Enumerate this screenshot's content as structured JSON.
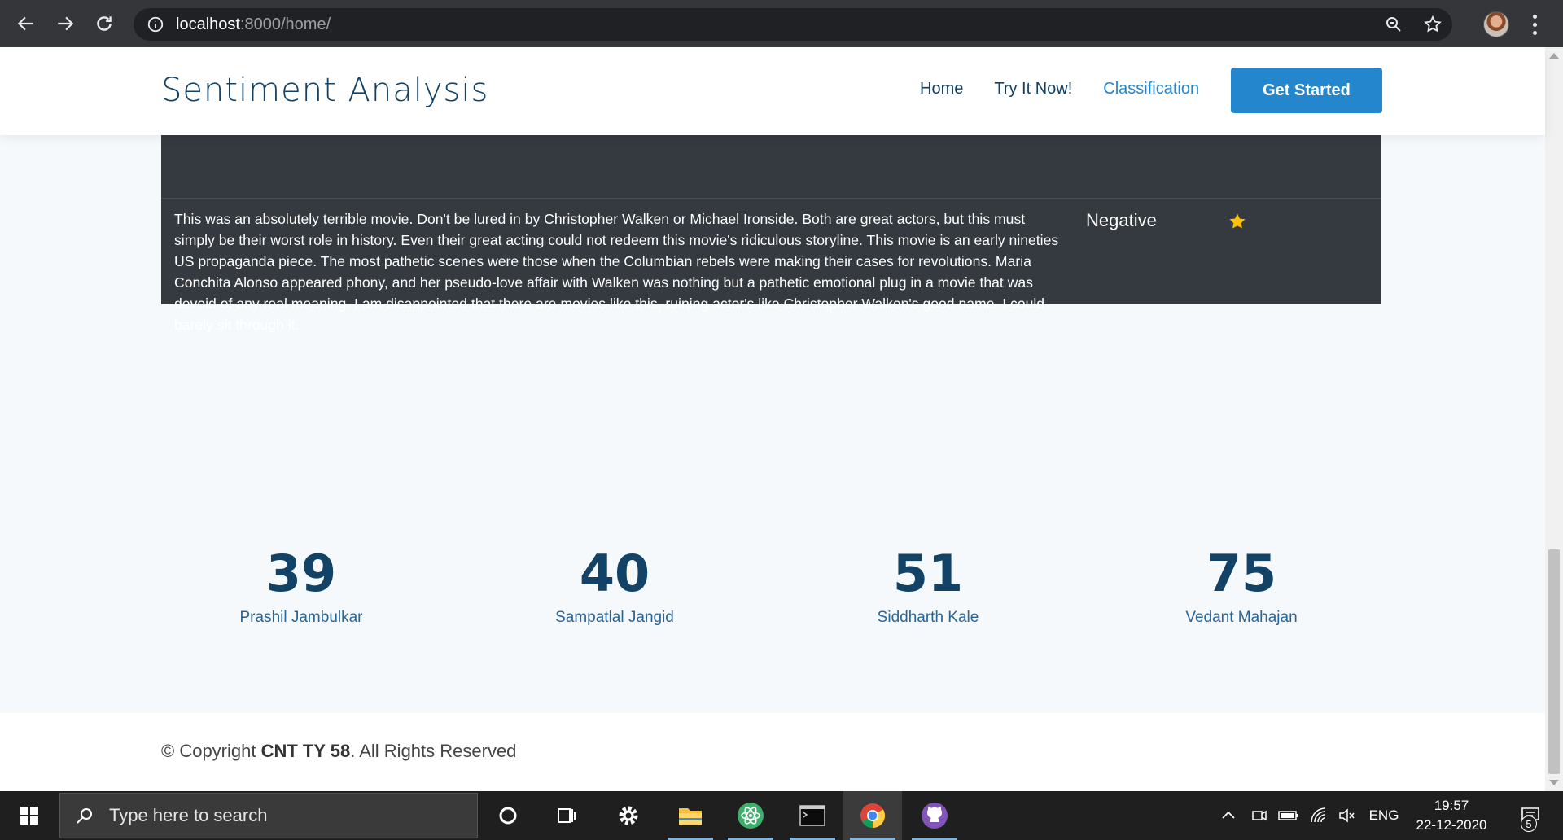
{
  "browser": {
    "url_host": "localhost",
    "url_path": ":8000/home/"
  },
  "site": {
    "logo": "Sentiment Analysis",
    "nav": {
      "home": "Home",
      "try_it_now": "Try It Now!",
      "classification": "Classification"
    },
    "cta": "Get Started"
  },
  "review": {
    "text": "This was an absolutely terrible movie. Don't be lured in by Christopher Walken or Michael Ironside. Both are great actors, but this must simply be their worst role in history. Even their great acting could not redeem this movie's ridiculous storyline. This movie is an early nineties US propaganda piece. The most pathetic scenes were those when the Columbian rebels were making their cases for revolutions. Maria Conchita Alonso appeared phony, and her pseudo-love affair with Walken was nothing but a pathetic emotional plug in a movie that was devoid of any real meaning. I am disappointed that there are movies like this, ruining actor's like Christopher Walken's good name. I could barely sit through it.",
    "sentiment": "Negative",
    "rating_icon": "star-icon",
    "rating_color": "#ffc107"
  },
  "counts": [
    {
      "number": "39",
      "name": "Prashil Jambulkar"
    },
    {
      "number": "40",
      "name": "Sampatlal Jangid"
    },
    {
      "number": "51",
      "name": "Siddharth Kale"
    },
    {
      "number": "75",
      "name": "Vedant Mahajan"
    }
  ],
  "footer": {
    "prefix": "© Copyright ",
    "org": "CNT TY 58",
    "suffix": ". All Rights Reserved"
  },
  "taskbar": {
    "search_placeholder": "Type here to search",
    "language": "ENG",
    "time": "19:57",
    "date": "22-12-2020",
    "notification_count": "5"
  },
  "colors": {
    "brand": "#124265",
    "accent": "#2487ce",
    "dark_table": "#343a40"
  }
}
